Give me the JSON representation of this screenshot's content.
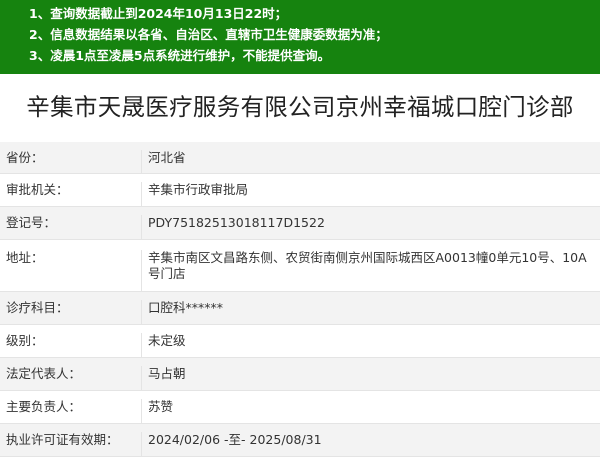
{
  "notice": {
    "lines": [
      "1、查询数据截止到2024年10月13日22时；",
      "2、信息数据结果以各省、自治区、直辖市卫生健康委数据为准；",
      "3、凌晨1点至凌晨5点系统进行维护，不能提供查询。"
    ]
  },
  "title": "辛集市天晟医疗服务有限公司京州幸福城口腔门诊部",
  "fields": [
    {
      "label": "省份：",
      "value": "河北省"
    },
    {
      "label": "审批机关：",
      "value": "辛集市行政审批局"
    },
    {
      "label": "登记号：",
      "value": "PDY75182513018117D1522"
    },
    {
      "label": "地址：",
      "value": "辛集市南区文昌路东侧、农贸街南侧京州国际城西区A0013幢0单元10号、10A号门店"
    },
    {
      "label": "诊疗科目：",
      "value": "口腔科******"
    },
    {
      "label": "级别：",
      "value": "未定级"
    },
    {
      "label": "法定代表人：",
      "value": "马占朝"
    },
    {
      "label": "主要负责人：",
      "value": "苏赞"
    },
    {
      "label": "执业许可证有效期：",
      "value": "2024/02/06 -至- 2025/08/31"
    }
  ]
}
